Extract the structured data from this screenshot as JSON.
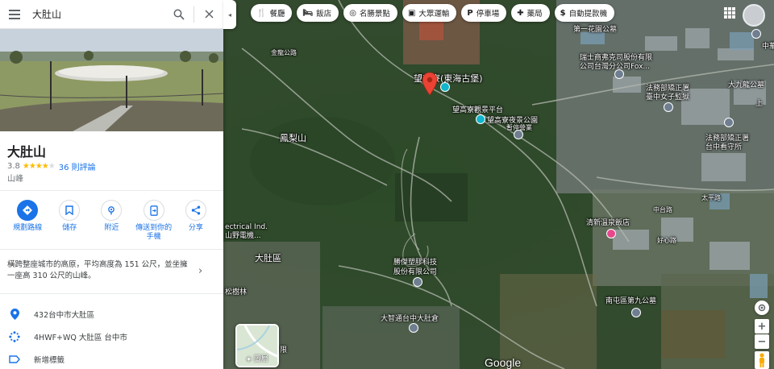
{
  "search": {
    "query": "大肚山"
  },
  "collapse_glyph": "◂",
  "place": {
    "name": "大肚山",
    "rating": "3.8",
    "stars": 4,
    "reviews": "36 則評論",
    "category": "山峰",
    "actions": [
      {
        "label": "規劃路線",
        "icon": "directions-icon"
      },
      {
        "label": "儲存",
        "icon": "bookmark-icon"
      },
      {
        "label": "附近",
        "icon": "nearby-icon"
      },
      {
        "label": "傳送到你的\n手機",
        "icon": "send-to-phone-icon"
      },
      {
        "label": "分享",
        "icon": "share-icon"
      }
    ],
    "description": "橫跨整座城市的高原，平均高度為 151 公尺，並坐擁一座高 310 公尺的山峰。",
    "address": "432台中市大肚區",
    "plus_code": "4HWF+WQ 大肚區 台中市",
    "add_label": "新增標籤"
  },
  "chips": [
    {
      "label": "餐廳",
      "glyph": "🍴"
    },
    {
      "label": "飯店",
      "glyph": "🛏"
    },
    {
      "label": "名勝景點",
      "glyph": "◎"
    },
    {
      "label": "大眾運輸",
      "glyph": "▣"
    },
    {
      "label": "停車場",
      "glyph": "P"
    },
    {
      "label": "藥局",
      "glyph": "✚"
    },
    {
      "label": "自動提款機",
      "glyph": "$"
    }
  ],
  "map": {
    "labels": {
      "flower_park": "第一花園公墓",
      "swiss": "瑞士商弗克司股份有限\n公司台灣分公司Fox...",
      "dahu_park": "大九龍公墓",
      "wanggao_house": "望高寮(東海古堡)",
      "wanggao_platform": "望高寮觀景平台",
      "wanggao_night": "望高寮夜景公園",
      "temporary": "暫停營業",
      "women_prison": "法務部矯正署\n臺中女子監獄",
      "detention": "法務部矯正署\n台中看守所",
      "fenglishan": "鳳梨山",
      "electrical": "ectrical Ind.\n山野電機...",
      "dadu_district": "大肚區",
      "pines": "松樹林",
      "shengjie": "勝傑塑膠科技\n股份有限公司",
      "dazhi": "大智通台中大肚倉",
      "qingxin": "清新溫泉飯店",
      "south_park": "南屯區第九公墓",
      "haoxing": "好心路",
      "taiping": "太平路",
      "zhongtai": "中台路",
      "jinyuan": "金龍公路",
      "upper": "上",
      "partial_right": "中華",
      "partial_bottom": "勝",
      "partial_bottom2": "限"
    },
    "layers_label": "圖層",
    "logo": "Google"
  }
}
